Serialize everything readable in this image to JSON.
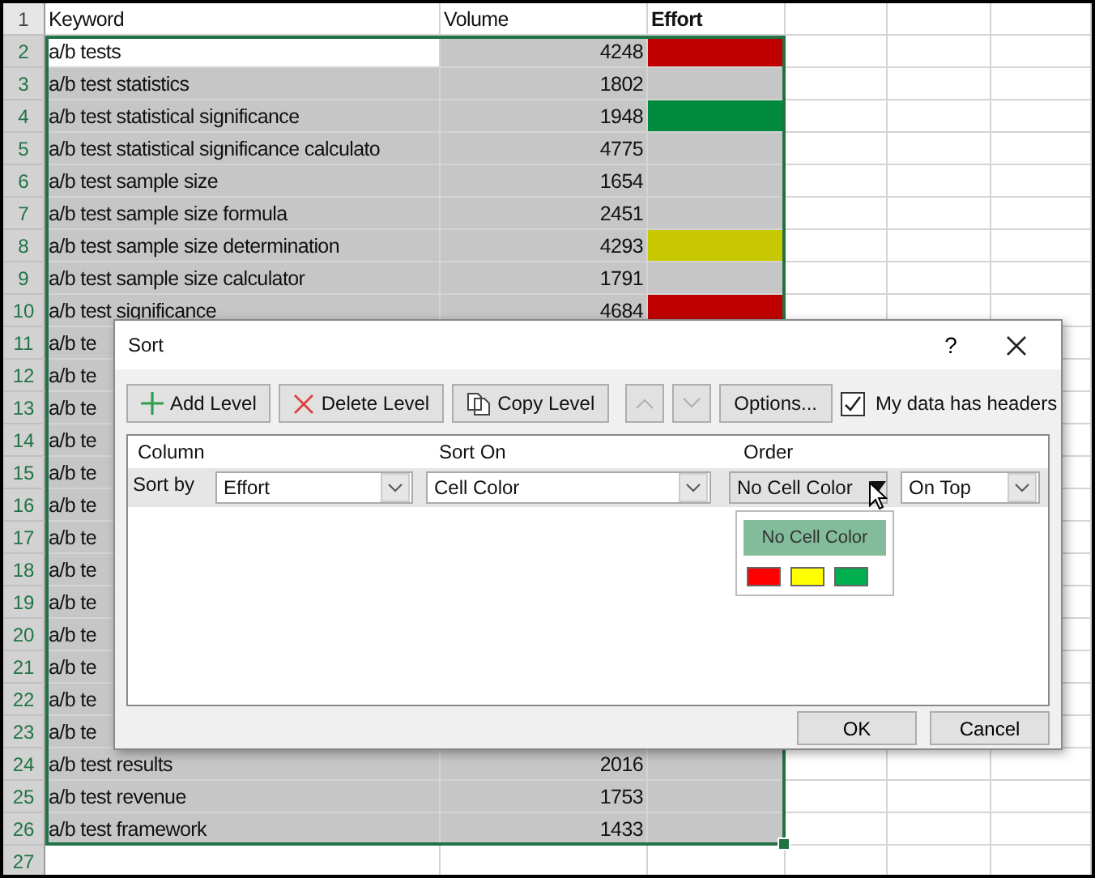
{
  "sheet": {
    "columns": [
      "Keyword",
      "Volume",
      "Effort"
    ],
    "rows": [
      {
        "number": "2",
        "keyword": "a/b tests",
        "volume": "4248",
        "color": "#c00000"
      },
      {
        "number": "3",
        "keyword": "a/b test statistics",
        "volume": "1802"
      },
      {
        "number": "4",
        "keyword": "a/b test statistical significance",
        "volume": "1948",
        "color": "#008a3e"
      },
      {
        "number": "5",
        "keyword": "a/b test statistical significance calculato",
        "volume": "4775"
      },
      {
        "number": "6",
        "keyword": "a/b test sample size",
        "volume": "1654"
      },
      {
        "number": "7",
        "keyword": "a/b test sample size formula",
        "volume": "2451"
      },
      {
        "number": "8",
        "keyword": "a/b test sample size determination",
        "volume": "4293",
        "color": "#c8c800"
      },
      {
        "number": "9",
        "keyword": "a/b test sample size calculator",
        "volume": "1791"
      },
      {
        "number": "10",
        "keyword": "a/b test significance",
        "volume": "4684",
        "color": "#c00000"
      },
      {
        "number": "11",
        "keyword": "a/b te"
      },
      {
        "number": "12",
        "keyword": "a/b te"
      },
      {
        "number": "13",
        "keyword": "a/b te"
      },
      {
        "number": "14",
        "keyword": "a/b te"
      },
      {
        "number": "15",
        "keyword": "a/b te"
      },
      {
        "number": "16",
        "keyword": "a/b te"
      },
      {
        "number": "17",
        "keyword": "a/b te"
      },
      {
        "number": "18",
        "keyword": "a/b te"
      },
      {
        "number": "19",
        "keyword": "a/b te"
      },
      {
        "number": "20",
        "keyword": "a/b te"
      },
      {
        "number": "21",
        "keyword": "a/b te"
      },
      {
        "number": "22",
        "keyword": "a/b te"
      },
      {
        "number": "23",
        "keyword": "a/b te"
      },
      {
        "number": "24",
        "keyword": "a/b test results",
        "volume": "2016"
      },
      {
        "number": "25",
        "keyword": "a/b test revenue",
        "volume": "1753"
      },
      {
        "number": "26",
        "keyword": "a/b test framework",
        "volume": "1433"
      },
      {
        "number": "27"
      }
    ],
    "header_number": "1"
  },
  "dialog": {
    "title": "Sort",
    "help": "?",
    "toolbar": [
      {
        "kind": "add",
        "label": "Add Level",
        "disabled": false
      },
      {
        "kind": "delete",
        "label": "Delete Level",
        "disabled": false
      },
      {
        "kind": "copy",
        "label": "Copy Level",
        "disabled": false
      },
      {
        "kind": "up",
        "disabled": true
      },
      {
        "kind": "down",
        "disabled": true
      },
      {
        "kind": "text",
        "label": "Options...",
        "disabled": false
      }
    ],
    "headers_checkbox": {
      "label": "My data has headers",
      "checked": true
    },
    "columns": [
      "Column",
      "Sort On",
      "Order"
    ],
    "level": {
      "label": "Sort by",
      "column": "Effort",
      "sort_on": "Cell Color",
      "order": "No Cell Color",
      "position": "On Top"
    },
    "color_menu": {
      "items": [
        {
          "label": "No Cell Color",
          "selected": true
        }
      ],
      "swatches": [
        {
          "color": "#ff0000"
        },
        {
          "color": "#ffff00"
        },
        {
          "color": "#00b050"
        }
      ]
    },
    "buttons": [
      "OK",
      "Cancel"
    ]
  }
}
